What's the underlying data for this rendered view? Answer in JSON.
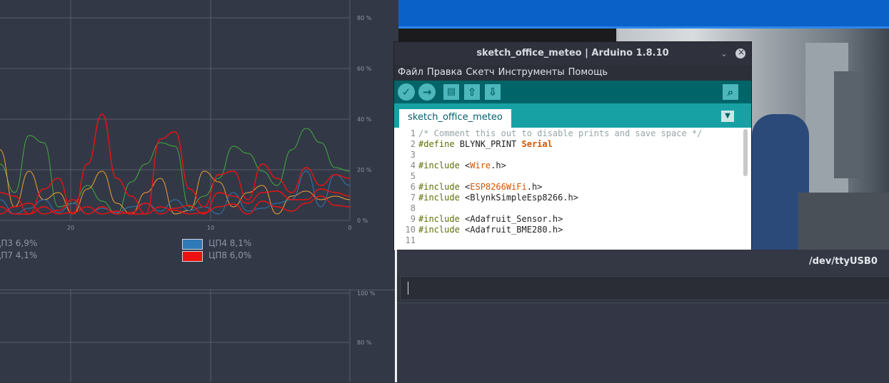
{
  "sysmon": {
    "cpu_chart": {
      "y_ticks": [
        "80 %",
        "60 %",
        "40 %",
        "20 %",
        "0 %"
      ],
      "x_ticks": [
        "20",
        "10",
        "0"
      ],
      "colors": {
        "cpu3": "#f0a030",
        "cpu4": "#2e7ab8",
        "cpu7": "#3fae3f",
        "cpu8": "#ee1111"
      }
    },
    "legend": {
      "cpu3": "ЦП3 6,9%",
      "cpu7": "ЦП7 4,1%",
      "cpu4": "ЦП4 8,1%",
      "cpu8": "ЦП8 6,0%"
    },
    "mem_chart": {
      "y_ticks": [
        "100 %",
        "80 %"
      ]
    }
  },
  "arduino": {
    "title": "sketch_office_meteo | Arduino 1.8.10",
    "minimize_icon": "chevron-down-icon",
    "menu": [
      "Файл",
      "Правка",
      "Скетч",
      "Инструменты",
      "Помощь"
    ],
    "toolbar": {
      "verify": "checkmark-icon",
      "upload": "arrow-right-icon",
      "new": "new-file-icon",
      "open": "arrow-up-icon",
      "save": "arrow-down-icon",
      "serial_monitor": "magnifier-icon"
    },
    "tab": "sketch_office_meteo",
    "code_lines": [
      {
        "n": "1",
        "segments": [
          {
            "t": "/* Comment this out to disable prints and save space */",
            "c": "c-comment"
          }
        ]
      },
      {
        "n": "2",
        "segments": [
          {
            "t": "#define",
            "c": "c-pre"
          },
          {
            "t": " BLYNK_PRINT ",
            "c": ""
          },
          {
            "t": "Serial",
            "c": "c-kw"
          }
        ]
      },
      {
        "n": "3",
        "segments": []
      },
      {
        "n": "4",
        "segments": [
          {
            "t": "#include",
            "c": "c-pre"
          },
          {
            "t": " <",
            "c": ""
          },
          {
            "t": "Wire",
            "c": "c-lib"
          },
          {
            "t": ".h>",
            "c": ""
          }
        ]
      },
      {
        "n": "5",
        "segments": []
      },
      {
        "n": "6",
        "segments": [
          {
            "t": "#include",
            "c": "c-pre"
          },
          {
            "t": " <",
            "c": ""
          },
          {
            "t": "ESP8266WiFi",
            "c": "c-lib"
          },
          {
            "t": ".h>",
            "c": ""
          }
        ]
      },
      {
        "n": "7",
        "segments": [
          {
            "t": "#include",
            "c": "c-pre"
          },
          {
            "t": " <BlynkSimpleEsp8266.h>",
            "c": ""
          }
        ]
      },
      {
        "n": "8",
        "segments": []
      },
      {
        "n": "9",
        "segments": [
          {
            "t": "#include",
            "c": "c-pre"
          },
          {
            "t": " <Adafruit_Sensor.h>",
            "c": ""
          }
        ]
      },
      {
        "n": "10",
        "segments": [
          {
            "t": "#include",
            "c": "c-pre"
          },
          {
            "t": " <Adafruit_BME280.h>",
            "c": ""
          }
        ]
      },
      {
        "n": "11",
        "segments": []
      }
    ]
  },
  "serial": {
    "title": "/dev/ttyUSB0",
    "input_value": ""
  }
}
